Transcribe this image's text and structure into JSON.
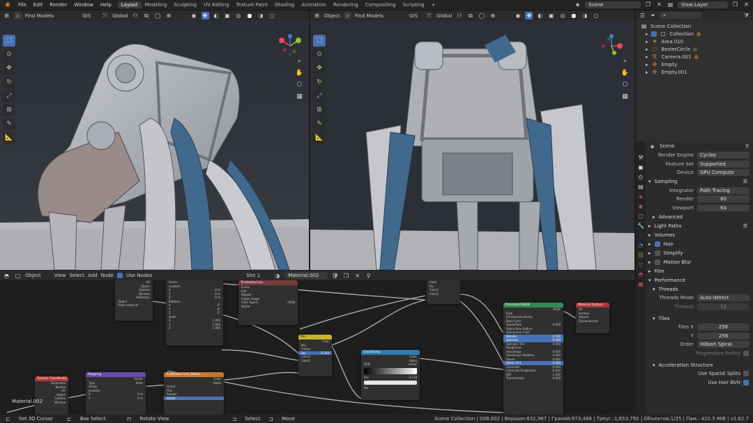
{
  "topbar": {
    "menu": [
      "File",
      "Edit",
      "Render",
      "Window",
      "Help"
    ],
    "tabs": [
      "Layout",
      "Modeling",
      "Sculpting",
      "UV Editing",
      "Texture Paint",
      "Shading",
      "Animation",
      "Rendering",
      "Compositing",
      "Scripting"
    ],
    "active_tab": "Layout",
    "scene": "Scene",
    "view_layer": "View Layer"
  },
  "viewport_left": {
    "find_models": "Find Models",
    "gis": "GIS",
    "orientation": "Global"
  },
  "viewport_right": {
    "mode": "Object",
    "find_models": "Find Models",
    "gis": "GIS",
    "orientation": "Global"
  },
  "outliner": {
    "root": "Scene Collection",
    "items": [
      {
        "label": "Collection",
        "icon": "collection-icon"
      },
      {
        "label": "Area.010",
        "icon": "light-icon"
      },
      {
        "label": "BezierCircle",
        "icon": "curve-icon"
      },
      {
        "label": "Camera.001",
        "icon": "camera-icon"
      },
      {
        "label": "Empty",
        "icon": "empty-icon"
      },
      {
        "label": "Empty.001",
        "icon": "empty-icon"
      }
    ]
  },
  "properties": {
    "scene": "Scene",
    "render_engine_label": "Render Engine",
    "render_engine": "Cycles",
    "feature_set_label": "Feature Set",
    "feature_set": "Supported",
    "device_label": "Device",
    "device": "GPU Compute",
    "sampling": "Sampling",
    "integrator_label": "Integrator",
    "integrator": "Path Tracing",
    "render_label": "Render",
    "render_samples": "80",
    "viewport_label": "Viewport",
    "viewport_samples": "64",
    "advanced": "Advanced",
    "light_paths": "Light Paths",
    "volumes": "Volumes",
    "hair": "Hair",
    "simplify": "Simplify",
    "motion_blur": "Motion Blur",
    "film": "Film",
    "performance": "Performance",
    "threads": "Threads",
    "threads_mode_label": "Threads Mode",
    "threads_mode": "Auto-detect",
    "threads_count_label": "Threads",
    "threads_count": "12",
    "tiles": "Tiles",
    "tiles_x_label": "Tiles X",
    "tiles_x": "256",
    "tiles_y_label": "Y",
    "tiles_y": "256",
    "order_label": "Order",
    "order": "Hilbert Spiral",
    "progressive_refine": "Progressive Refine",
    "acceleration": "Acceleration Structure",
    "spatial_splits": "Use Spatial Splits",
    "hair_bvh": "Use Hair BVH"
  },
  "node_editor": {
    "mode": "Object",
    "menu": [
      "View",
      "Select",
      "Add",
      "Node"
    ],
    "use_nodes": "Use Nodes",
    "slot": "Slot 1",
    "material": "Material.002",
    "material_label": "Material.002",
    "nodes": {
      "texcoord": "Texture Coordinate",
      "mapping": "Mapping",
      "mix": "Mix",
      "colorramp": "ColorRamp",
      "principled": "Principled BSDF",
      "output": "Material Output",
      "image1": "TreetexturCon..",
      "image2": "TreetexturCorn_Metal..."
    }
  },
  "statusbar": {
    "set_cursor": "Set 3D Cursor",
    "box_select": "Box Select",
    "rotate_view": "Rotate View",
    "select": "Select",
    "move": "Move",
    "stats": "Scene Collection | 008.002 | Вершин:832,987 | Граней:973,488 | Треуг.:1,653,792 | Объектов:1/25 | Пам.: 422.5 MiB | v2.82.7"
  }
}
